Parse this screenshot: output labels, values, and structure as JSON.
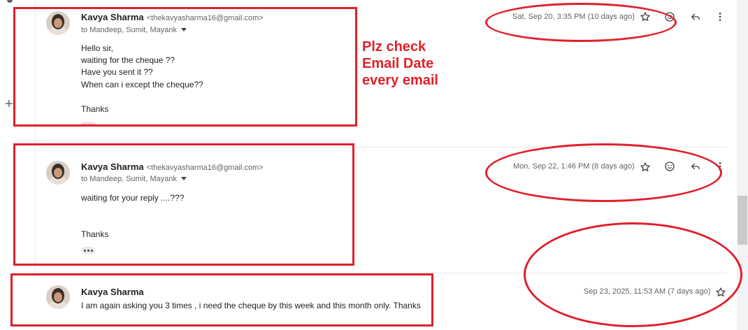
{
  "emails": [
    {
      "sender_name": "Kavya Sharma",
      "sender_email": "<thekavyasharma16@gmail.com>",
      "recipients": "to Mandeep, Sumit, Mayank",
      "date": "Sat, Sep 20, 3:35 PM (10 days ago)",
      "body": [
        "Hello sir,",
        "waiting for the cheque ??",
        "Have you sent it ??",
        "When can i except  the cheque??",
        "",
        "Thanks"
      ]
    },
    {
      "sender_name": "Kavya Sharma",
      "sender_email": "<thekavyasharma16@gmail.com>",
      "recipients": "to Mandeep, Sumit, Mayank",
      "date": "Mon, Sep 22, 1:46 PM (8 days ago)",
      "body": [
        "waiting for your reply ....???",
        "",
        "",
        "Thanks"
      ]
    },
    {
      "sender_name": "Kavya Sharma",
      "snippet": "I am again asking you 3 times , i need the cheque by this week and this month only. Thanks",
      "date": "Sep 23, 2025, 11:53 AM (7 days ago)"
    }
  ],
  "annotation": {
    "lines": [
      "Plz check",
      "Email Date",
      "every email"
    ],
    "color": "#e0202a"
  },
  "icons": [
    "star-icon",
    "emoji-icon",
    "reply-icon",
    "more-vert-icon",
    "expand-plus-icon",
    "show-trimmed-icon"
  ],
  "colors": {
    "annotation_red": "#e0202a",
    "secondary_text": "#5f6368"
  }
}
